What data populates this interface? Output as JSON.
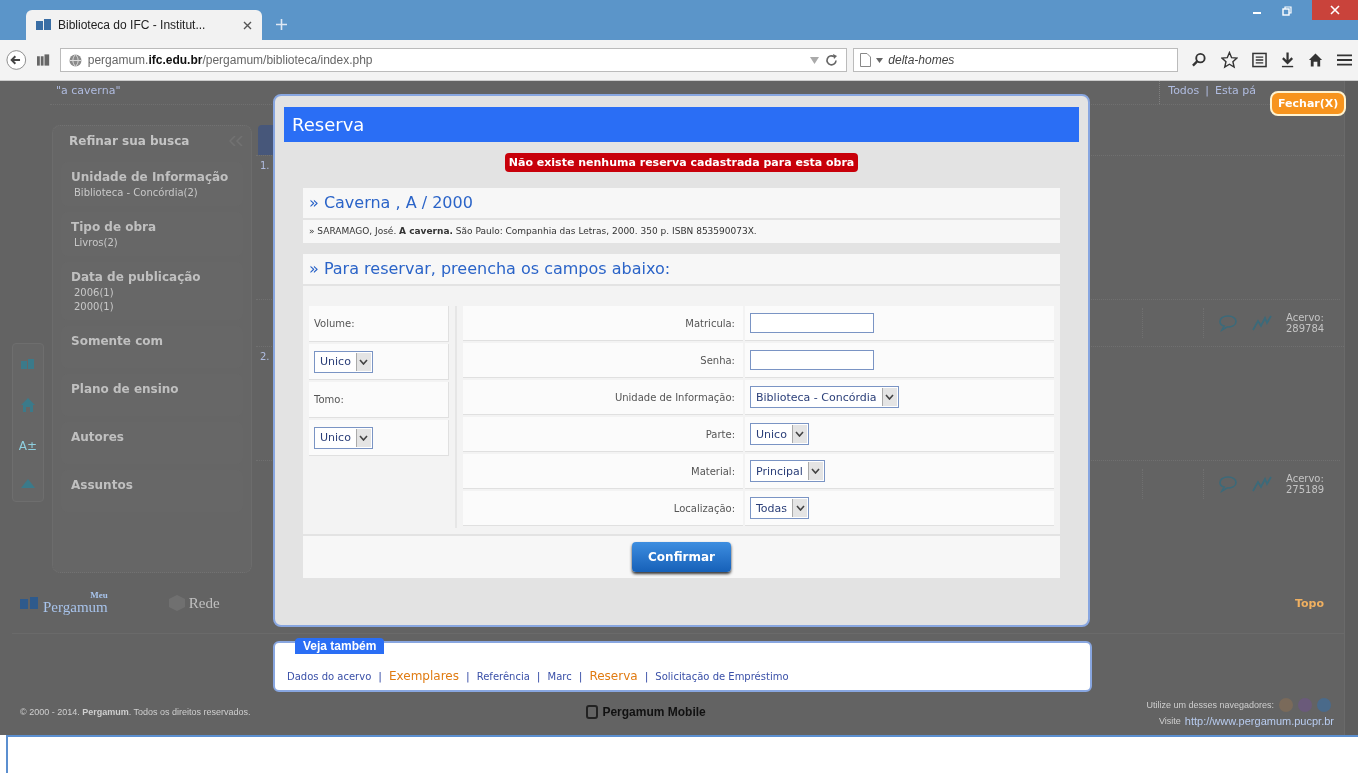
{
  "browser": {
    "tab_title": "Biblioteca do IFC - Institut...",
    "url": "pergamum.**ifc.edu.br**/pergamum/biblioteca/index.php",
    "search_value": "delta-homes"
  },
  "page": {
    "search_term": "\"a caverna\"",
    "scope_links": [
      "Todos",
      "Esta pá"
    ],
    "scope_separator": "|",
    "sidebar": {
      "title": "Refinar sua busca",
      "sections": [
        {
          "title": "Unidade de Informação",
          "items": [
            "Biblioteca - Concórdia(2)"
          ]
        },
        {
          "title": "Tipo de obra",
          "items": [
            "Livros(2)"
          ]
        },
        {
          "title": "Data de publicação",
          "items": [
            "2006(1)",
            "2000(1)"
          ]
        },
        {
          "title": "Somente com"
        },
        {
          "title": "Plano de ensino"
        },
        {
          "title": "Autores"
        },
        {
          "title": "Assuntos"
        }
      ]
    },
    "side_tools": [
      "A±"
    ],
    "results": [
      {
        "number": "1.",
        "acervo_label": "Acervo:",
        "acervo_number": "289784"
      },
      {
        "number": "2.",
        "acervo_label": "Acervo:",
        "acervo_number": "275189"
      }
    ],
    "footer": {
      "logos": [
        {
          "kind": "meu",
          "label": "Meu",
          "name": "Pergamum"
        },
        {
          "kind": "rede",
          "name": "Rede"
        }
      ],
      "top_link": "Topo",
      "copyright": "© 2000 - 2014. **Pergamum**. Todos os direitos reservados.",
      "mobile": "Pergamum Mobile",
      "browsers_note": "Utilize um desses navegadores:",
      "visit_label": "Visite",
      "visit_link": "http://www.pergamum.pucpr.br"
    }
  },
  "modal": {
    "title": "Reserva",
    "close": "Fechar(X)",
    "alert": "Não existe nenhuma reserva cadastrada para esta obra",
    "work_title": "» Caverna , A / 2000",
    "citation": "» SARAMAGO, José. **A caverna.** São Paulo: Companhia das Letras, 2000. 350 p. ISBN 853590073X.",
    "form_heading": "» Para reservar, preencha os campos abaixo:",
    "left_fields": [
      {
        "label": "Volume:",
        "value": "Unico"
      },
      {
        "label": "Tomo:",
        "value": "Unico"
      }
    ],
    "right_fields": [
      {
        "label": "Matricula:",
        "kind": "text"
      },
      {
        "label": "Senha:",
        "kind": "text"
      },
      {
        "label": "Unidade de Informação:",
        "kind": "select",
        "value": "Biblioteca - Concórdia"
      },
      {
        "label": "Parte:",
        "kind": "select",
        "value": "Unico"
      },
      {
        "label": "Material:",
        "kind": "select",
        "value": "Principal"
      },
      {
        "label": "Localização:",
        "kind": "select",
        "value": "Todas"
      }
    ],
    "confirm": "Confirmar"
  },
  "see_also": {
    "title": "Veja também",
    "separator": "|",
    "links": [
      {
        "text": "Dados do acervo",
        "emphasized": false
      },
      {
        "text": "Exemplares",
        "emphasized": true
      },
      {
        "text": "Referência",
        "emphasized": false
      },
      {
        "text": "Marc",
        "emphasized": false
      },
      {
        "text": "Reserva",
        "emphasized": true
      },
      {
        "text": "Solicitação de Empréstimo",
        "emphasized": false
      }
    ]
  }
}
